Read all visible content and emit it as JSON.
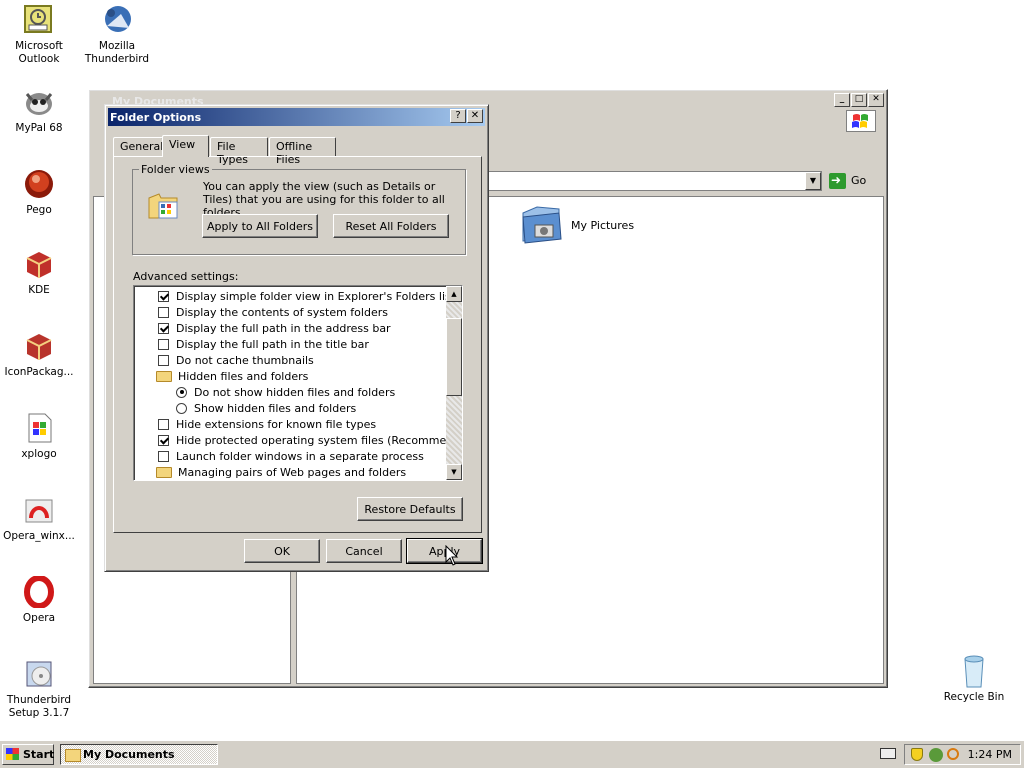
{
  "desktop": {
    "icons": [
      {
        "label": "Microsoft\nOutlook",
        "icon": "outlook-icon"
      },
      {
        "label": "Mozilla\nThunderbird",
        "icon": "thunderbird-icon"
      },
      {
        "label": "MyPal 68",
        "icon": "mypal-icon"
      },
      {
        "label": "Pego",
        "icon": "pego-icon"
      },
      {
        "label": "KDE",
        "icon": "kde-icon"
      },
      {
        "label": "IconPackag...",
        "icon": "iconpackager-icon"
      },
      {
        "label": "xplogo",
        "icon": "xplogo-icon"
      },
      {
        "label": "Opera_winx...",
        "icon": "opera-installer-icon"
      },
      {
        "label": "Opera",
        "icon": "opera-icon"
      },
      {
        "label": "Thunderbird\nSetup 3.1.7",
        "icon": "thunderbird-setup-icon"
      },
      {
        "label": "Recycle Bin",
        "icon": "recycle-bin-icon"
      }
    ]
  },
  "explorer": {
    "title": "My Documents",
    "go_label": "Go",
    "folder_item": "My Pictures",
    "controls": {
      "minimize": "_",
      "maximize": "□",
      "close": "✕"
    }
  },
  "dialog": {
    "title": "Folder Options",
    "help": "?",
    "close": "✕",
    "tabs": [
      "General",
      "View",
      "File Types",
      "Offline Files"
    ],
    "active_tab": "View",
    "folder_views": {
      "legend": "Folder views",
      "text": "You can apply the view (such as Details or Tiles) that you are using for this folder to all folders.",
      "apply_all": "Apply to All Folders",
      "reset_all": "Reset All Folders"
    },
    "advanced_label": "Advanced settings:",
    "advanced": [
      {
        "type": "checkbox",
        "checked": true,
        "label": "Display simple folder view in Explorer's Folders list"
      },
      {
        "type": "checkbox",
        "checked": false,
        "label": "Display the contents of system folders"
      },
      {
        "type": "checkbox",
        "checked": true,
        "label": "Display the full path in the address bar"
      },
      {
        "type": "checkbox",
        "checked": false,
        "label": "Display the full path in the title bar"
      },
      {
        "type": "checkbox",
        "checked": false,
        "label": "Do not cache thumbnails"
      },
      {
        "type": "folder",
        "label": "Hidden files and folders"
      },
      {
        "type": "radio",
        "checked": true,
        "label": "Do not show hidden files and folders"
      },
      {
        "type": "radio",
        "checked": false,
        "label": "Show hidden files and folders"
      },
      {
        "type": "checkbox",
        "checked": false,
        "label": "Hide extensions for known file types"
      },
      {
        "type": "checkbox",
        "checked": true,
        "label": "Hide protected operating system files (Recommended)"
      },
      {
        "type": "checkbox",
        "checked": false,
        "label": "Launch folder windows in a separate process"
      },
      {
        "type": "folder",
        "label": "Managing pairs of Web pages and folders"
      }
    ],
    "restore_defaults": "Restore Defaults",
    "ok": "OK",
    "cancel": "Cancel",
    "apply": "Apply"
  },
  "taskbar": {
    "start": "Start",
    "task": "My Documents",
    "clock": "1:24 PM"
  },
  "colors": {
    "dialog_title_start": "#0a246a",
    "dialog_title_end": "#a6caf0",
    "face": "#d4d0c8"
  }
}
